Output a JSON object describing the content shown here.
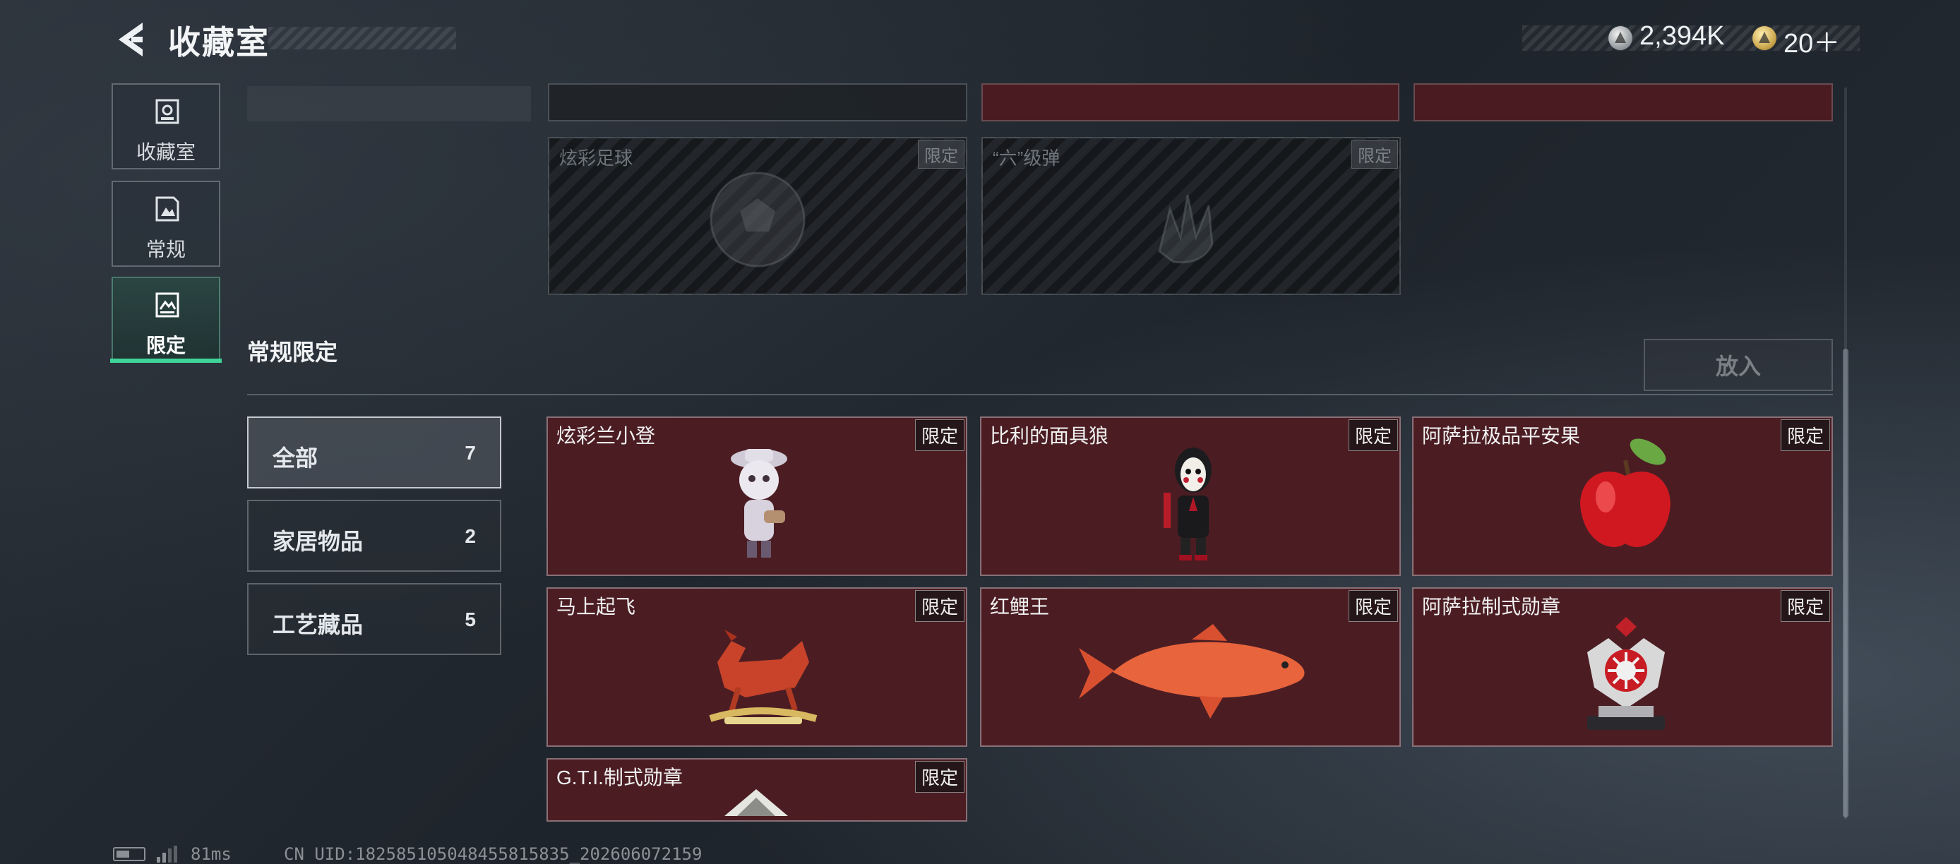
{
  "header": {
    "title": "收藏室",
    "back_icon": "chevron-left-icon"
  },
  "currency": {
    "silver_value": "2,394K",
    "gold_value": "20＋"
  },
  "sidebar": {
    "items": [
      {
        "label": "收藏室",
        "icon": "collection-room-icon"
      },
      {
        "label": "常规",
        "icon": "regular-items-icon"
      },
      {
        "label": "限定",
        "icon": "limited-items-icon",
        "active": true
      }
    ]
  },
  "locked_items": [
    {
      "name": "炫彩足球",
      "tag": "限定"
    },
    {
      "name": "“六”级弹",
      "tag": "限定"
    }
  ],
  "section": {
    "title": "常规限定",
    "place_button": "放入"
  },
  "filters": [
    {
      "label": "全部",
      "count": "7",
      "active": true
    },
    {
      "label": "家居物品",
      "count": "2"
    },
    {
      "label": "工艺藏品",
      "count": "5"
    }
  ],
  "items": [
    {
      "name": "炫彩兰小登",
      "tag": "限定"
    },
    {
      "name": "比利的面具狼",
      "tag": "限定"
    },
    {
      "name": "阿萨拉极品平安果",
      "tag": "限定"
    },
    {
      "name": "马上起飞",
      "tag": "限定"
    },
    {
      "name": "红鲤王",
      "tag": "限定"
    },
    {
      "name": "阿萨拉制式勋章",
      "tag": "限定"
    },
    {
      "name": "G.T.I.制式勋章",
      "tag": "限定"
    }
  ],
  "status": {
    "ping": "81ms",
    "uid": "CN UID:1825851050484558158​35_202606072159"
  },
  "colors": {
    "accent": "#3fd49a",
    "card_bg": "#4b1d23"
  }
}
